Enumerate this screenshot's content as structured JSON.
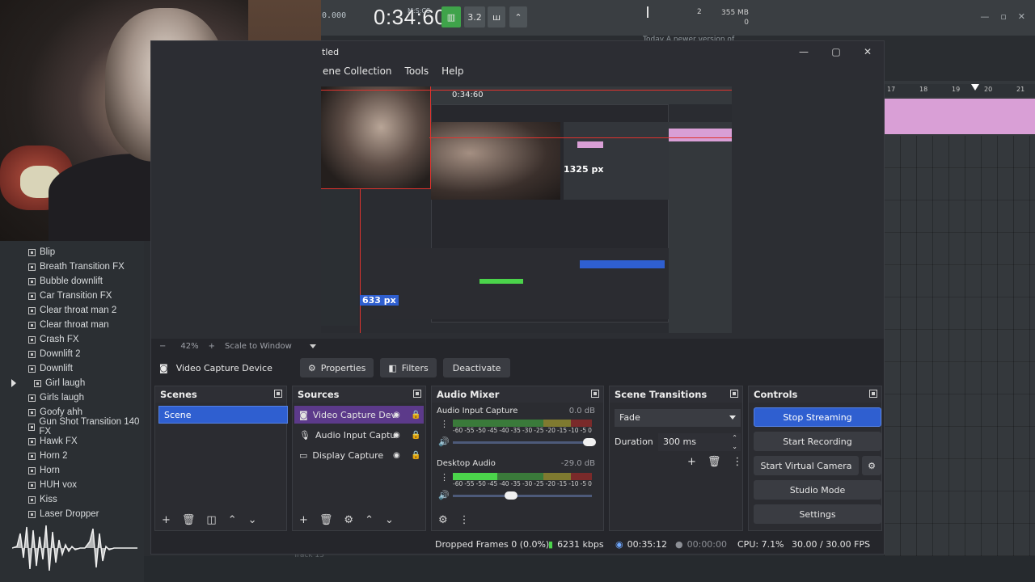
{
  "daw": {
    "readout": "0.000",
    "time_main": "0:34:60",
    "time_sub": "M:S:CS",
    "tempo": "3.2",
    "memory": "355 MB",
    "memory_sub": "0",
    "cpu_val": "2",
    "hint": "Today  A newer version of",
    "ruler_ticks": [
      "17",
      "18",
      "19",
      "20",
      "21"
    ],
    "track_label": "Track 13",
    "browser_items": [
      {
        "label": "Blip",
        "expanded": false
      },
      {
        "label": "Breath Transition FX",
        "expanded": false
      },
      {
        "label": "Bubble downlift",
        "expanded": false
      },
      {
        "label": "Car Transition FX",
        "expanded": false
      },
      {
        "label": "Clear throat man 2",
        "expanded": false
      },
      {
        "label": "Clear throat man",
        "expanded": false
      },
      {
        "label": "Crash FX",
        "expanded": false
      },
      {
        "label": "Downlift 2",
        "expanded": false
      },
      {
        "label": "Downlift",
        "expanded": false
      },
      {
        "label": "Girl laugh",
        "expanded": true
      },
      {
        "label": "Girls laugh",
        "expanded": false
      },
      {
        "label": "Goofy ahh",
        "expanded": false
      },
      {
        "label": "Gun Shot Transition 140 FX",
        "expanded": false
      },
      {
        "label": "Hawk FX",
        "expanded": false
      },
      {
        "label": "Horn 2",
        "expanded": false
      },
      {
        "label": "Horn",
        "expanded": false
      },
      {
        "label": "HUH vox",
        "expanded": false
      },
      {
        "label": "Kiss",
        "expanded": false
      },
      {
        "label": "Laser Dropper",
        "expanded": false
      }
    ]
  },
  "obs": {
    "title": "tled",
    "menu": [
      "ene Collection",
      "Tools",
      "Help"
    ],
    "preview": {
      "width_label": "1325 px",
      "height_label": "633 px",
      "nested_time": "0:34:60"
    },
    "zoom": {
      "minus": "−",
      "value": "42%",
      "plus": "+",
      "mode": "Scale to Window"
    },
    "source_toolbar": {
      "source_name": "Video Capture Device",
      "properties": "Properties",
      "filters": "Filters",
      "deactivate": "Deactivate"
    },
    "scenes": {
      "title": "Scenes",
      "items": [
        "Scene"
      ]
    },
    "sources": {
      "title": "Sources",
      "items": [
        "Video Capture Dev",
        "Audio Input Captu",
        "Display Capture"
      ]
    },
    "mixer": {
      "title": "Audio Mixer",
      "channels": [
        {
          "name": "Audio Input Capture",
          "db": "0.0 dB",
          "level": 0.0,
          "volume": 0.98
        },
        {
          "name": "Desktop Audio",
          "db": "-29.0 dB",
          "level": 0.32,
          "volume": 0.42
        }
      ],
      "scale": [
        "-60",
        "-55",
        "-50",
        "-45",
        "-40",
        "-35",
        "-30",
        "-25",
        "-20",
        "-15",
        "-10",
        "-5",
        "0"
      ]
    },
    "transitions": {
      "title": "Scene Transitions",
      "selected": "Fade",
      "duration_label": "Duration",
      "duration_value": "300 ms"
    },
    "controls": {
      "title": "Controls",
      "stop_streaming": "Stop Streaming",
      "start_recording": "Start Recording",
      "start_virtual_camera": "Start Virtual Camera",
      "studio_mode": "Studio Mode",
      "settings": "Settings"
    },
    "status": {
      "dropped_frames": "Dropped Frames 0 (0.0%)",
      "bitrate": "6231 kbps",
      "stream_time": "00:35:12",
      "rec_time": "00:00:00",
      "cpu": "CPU: 7.1%",
      "fps": "30.00 / 30.00 FPS"
    }
  },
  "colors": {
    "accent": "#2f5fd0",
    "daw_clip": "#d99fd6",
    "meter_green": "#4bd44b",
    "red_guide": "#e0332e"
  }
}
